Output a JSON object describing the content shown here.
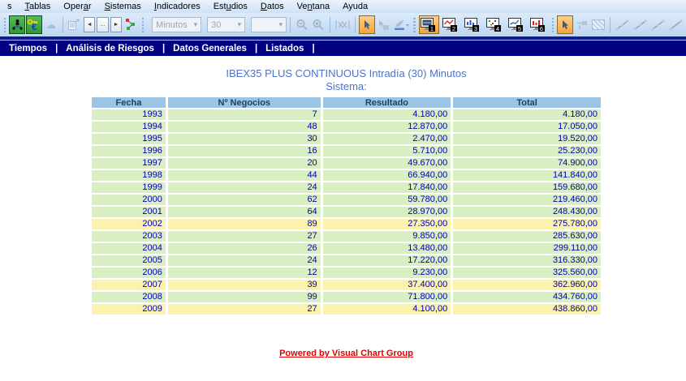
{
  "menubar": {
    "items": [
      {
        "id": "clipped",
        "pre": "s",
        "key": "",
        "post": ""
      },
      {
        "id": "tablas",
        "pre": "",
        "key": "T",
        "post": "ablas"
      },
      {
        "id": "operar",
        "pre": "Oper",
        "key": "a",
        "post": "r"
      },
      {
        "id": "sistemas",
        "pre": "",
        "key": "S",
        "post": "istemas"
      },
      {
        "id": "indicadores",
        "pre": "",
        "key": "I",
        "post": "ndicadores"
      },
      {
        "id": "estudios",
        "pre": "Est",
        "key": "u",
        "post": "dios"
      },
      {
        "id": "datos",
        "pre": "",
        "key": "D",
        "post": "atos"
      },
      {
        "id": "ventana",
        "pre": "Ve",
        "key": "n",
        "post": "tana"
      },
      {
        "id": "ayuda",
        "pre": "Ayuda",
        "key": "",
        "post": ""
      }
    ]
  },
  "toolbar": {
    "combos": [
      {
        "id": "periodo",
        "value": "Minutos"
      },
      {
        "id": "compresion",
        "value": "30"
      },
      {
        "id": "extra",
        "value": ""
      }
    ],
    "combo_arrow": "▾",
    "nav_buttons": {
      "prev": "◄",
      "ellipsis": "...",
      "next": "►"
    },
    "cloud_glyph": "☁",
    "monitors": [
      {
        "n": "1",
        "variant": "dark",
        "selected": true
      },
      {
        "n": "2",
        "variant": "redline",
        "selected": false
      },
      {
        "n": "3",
        "variant": "bluebars",
        "selected": false
      },
      {
        "n": "4",
        "variant": "dots",
        "selected": false
      },
      {
        "n": "5",
        "variant": "blueline",
        "selected": false
      },
      {
        "n": "6",
        "variant": "redbars",
        "selected": false
      }
    ]
  },
  "navbar": {
    "items": [
      "Tiempos",
      "Análisis de Riesgos",
      "Datos Generales",
      "Listados"
    ],
    "separator": "|"
  },
  "content": {
    "title": "IBEX35 PLUS CONTINUOUS Intradía (30) Minutos",
    "subtitle": "Sistema:",
    "footer_link": "Powered by Visual Chart Group"
  },
  "table": {
    "columns": [
      "Fecha",
      "Nº Negocios",
      "Resultado",
      "Total"
    ],
    "rows": [
      {
        "cells": [
          "1993",
          "7",
          "4.180,00",
          "4.180,00"
        ],
        "highlight": false
      },
      {
        "cells": [
          "1994",
          "48",
          "12.870,00",
          "17.050,00"
        ],
        "highlight": false
      },
      {
        "cells": [
          "1995",
          "30",
          "2.470,00",
          "19.520,00"
        ],
        "highlight": false
      },
      {
        "cells": [
          "1996",
          "16",
          "5.710,00",
          "25.230,00"
        ],
        "highlight": false
      },
      {
        "cells": [
          "1997",
          "20",
          "49.670,00",
          "74.900,00"
        ],
        "highlight": false
      },
      {
        "cells": [
          "1998",
          "44",
          "66.940,00",
          "141.840,00"
        ],
        "highlight": false
      },
      {
        "cells": [
          "1999",
          "24",
          "17.840,00",
          "159.680,00"
        ],
        "highlight": false
      },
      {
        "cells": [
          "2000",
          "62",
          "59.780,00",
          "219.460,00"
        ],
        "highlight": false
      },
      {
        "cells": [
          "2001",
          "64",
          "28.970,00",
          "248.430,00"
        ],
        "highlight": false
      },
      {
        "cells": [
          "2002",
          "89",
          "27.350,00",
          "275.780,00"
        ],
        "highlight": true
      },
      {
        "cells": [
          "2003",
          "27",
          "9.850,00",
          "285.630,00"
        ],
        "highlight": false
      },
      {
        "cells": [
          "2004",
          "26",
          "13.480,00",
          "299.110,00"
        ],
        "highlight": false
      },
      {
        "cells": [
          "2005",
          "24",
          "17.220,00",
          "316.330,00"
        ],
        "highlight": false
      },
      {
        "cells": [
          "2006",
          "12",
          "9.230,00",
          "325.560,00"
        ],
        "highlight": false
      },
      {
        "cells": [
          "2007",
          "39",
          "37.400,00",
          "362.960,00"
        ],
        "highlight": true
      },
      {
        "cells": [
          "2008",
          "99",
          "71.800,00",
          "434.760,00"
        ],
        "highlight": false
      },
      {
        "cells": [
          "2009",
          "27",
          "4.100,00",
          "438.860,00"
        ],
        "highlight": true
      }
    ]
  },
  "colors": {
    "navbar_bg": "#010080",
    "header_bg": "#9cc5e5",
    "row_green": "#d9efc3",
    "row_yellow": "#fbf2ad",
    "cell_text": "#0000aa",
    "title_blue": "#4e73c5",
    "footer_red": "#e00000"
  }
}
